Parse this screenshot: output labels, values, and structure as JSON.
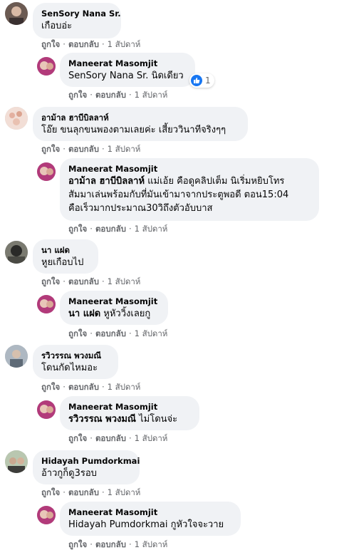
{
  "like_label": "ถูกใจ",
  "reply_label": "ตอบกลับ",
  "separator": "·",
  "comments": [
    {
      "author": "SenSory Nana Sr.",
      "text": "เกือบอ่ะ",
      "time": "1 สัปดาห์",
      "reply": {
        "author": "Maneerat Masomjit",
        "mention": "SenSory Nana Sr.",
        "text": " นิดเดียว",
        "reaction_count": "1",
        "time": "1 สัปดาห์"
      }
    },
    {
      "author": "อาม้าล ฮาบีบิลลาห์",
      "text": "โอ๊ย ขนลุกขนพองตามเลยค่ะ เสี้ยววินาทีจริงๆๆ",
      "time": "1 สัปดาห์",
      "reply": {
        "author": "Maneerat Masomjit",
        "mention": "อาม้าล ฮาบีบิลลาห์",
        "text": " แม่เอ้ย คือดูคลิปเต็ม นิเริ่มหยิบโทร",
        "text_line2": "สัมมาเล่นพร้อมกับที่มันเข้ามาจากประตูพอดี ตอน15:04",
        "text_line3": "คือเร็วมากประมาณ30วิถึงตัวอับบาส",
        "time": "1 สัปดาห์"
      }
    },
    {
      "author": "นา แฝด",
      "text": "หูยเกือบไป",
      "time": "1 สัปดาห์",
      "reply": {
        "author": "Maneerat Masomjit",
        "mention": "นา แฝด",
        "text": " หูหัววิ้งเลยกู",
        "time": "1 สัปดาห์"
      }
    },
    {
      "author": "รวิวรรณ พวงมณี",
      "text": "โดนกัดไหมอะ",
      "time": "1 สัปดาห์",
      "reply": {
        "author": "Maneerat Masomjit",
        "mention": "รวิวรรณ พวงมณี",
        "text": " ไม่โดนจ่ะ",
        "time": "1 สัปดาห์"
      }
    },
    {
      "author": "Hidayah Pumdorkmai",
      "text": "อ้าวกูก็ดู3รอบ",
      "time": "1 สัปดาห์",
      "reply": {
        "author": "Maneerat Masomjit",
        "mention": "Hidayah Pumdorkmai",
        "text": " กูหัวใจจะวาย",
        "time": "1 สัปดาห์"
      }
    }
  ],
  "colors": {
    "bubble": "#f0f2f5",
    "meta": "#65676b",
    "like_blue": "#1877f2"
  }
}
